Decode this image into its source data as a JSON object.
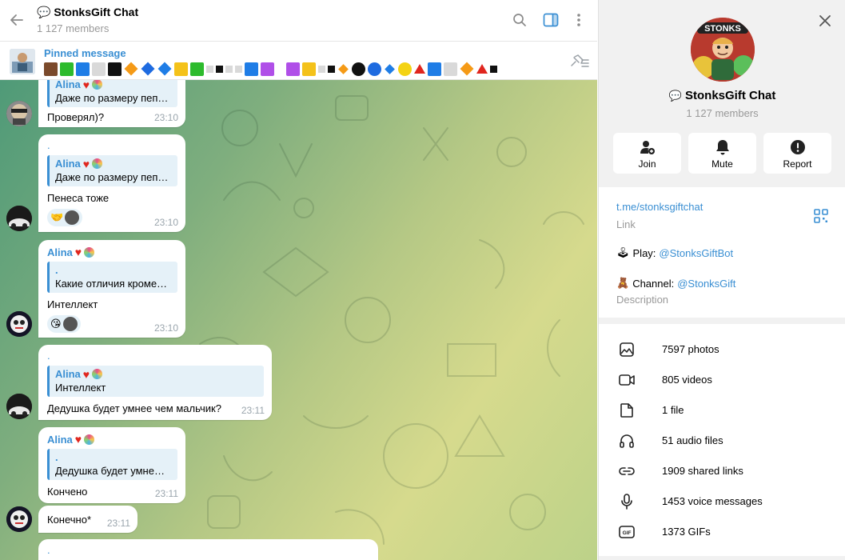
{
  "header": {
    "title": "StonksGift Chat",
    "members": "1 127 members"
  },
  "pinned": {
    "label": "Pinned message"
  },
  "messages": [
    {
      "reply_name": "Alina",
      "reply_text": "Даже по размеру пеп…",
      "text": "Проверял)?",
      "time": "23:10"
    },
    {
      "top_dot": ".",
      "reply_name": "Alina",
      "reply_text": "Даже по размеру пеп…",
      "text": "Пенеса тоже",
      "time": "23:10"
    },
    {
      "sender": "Alina",
      "reply_dot": ".",
      "reply_text": "Какие отличия кроме…",
      "text": "Интеллект",
      "time": "23:10"
    },
    {
      "top_dot": ".",
      "reply_name": "Alina",
      "reply_text": "Интеллект",
      "text": "Дедушка будет умнее чем мальчик?",
      "time": "23:11"
    },
    {
      "sender": "Alina",
      "reply_dot": ".",
      "reply_text": "Дедушка будет умне…",
      "text": "Кончено",
      "time": "23:11"
    },
    {
      "text": "Конечно*",
      "time": "23:11"
    },
    {
      "top_dot": "."
    }
  ],
  "info": {
    "name": "StonksGift Chat",
    "members": "1 127 members",
    "actions": [
      {
        "label": "Join",
        "icon": "add-user-icon"
      },
      {
        "label": "Mute",
        "icon": "bell-icon"
      },
      {
        "label": "Report",
        "icon": "report-icon"
      }
    ],
    "link": "t.me/stonksgiftchat",
    "link_caption": "Link",
    "play_label": "Play:",
    "play_mention": "@StonksGiftBot",
    "channel_label": "Channel:",
    "channel_mention": "@StonksGift",
    "description_caption": "Description",
    "media": [
      {
        "label": "7597 photos",
        "icon": "photo-icon"
      },
      {
        "label": "805 videos",
        "icon": "video-icon"
      },
      {
        "label": "1 file",
        "icon": "file-icon"
      },
      {
        "label": "51 audio files",
        "icon": "headphones-icon"
      },
      {
        "label": "1909 shared links",
        "icon": "link-icon"
      },
      {
        "label": "1453 voice messages",
        "icon": "mic-icon"
      },
      {
        "label": "1373 GIFs",
        "icon": "gif-icon"
      }
    ],
    "gif_badge": "GIF",
    "avatar_text": "STONKS"
  },
  "colors": {
    "accent": "#3a8fd3",
    "heart": "#e0261e"
  }
}
